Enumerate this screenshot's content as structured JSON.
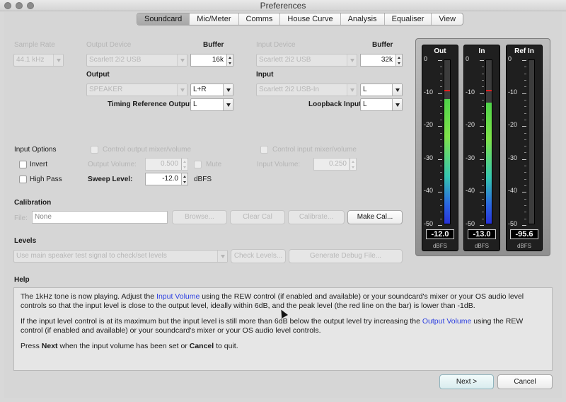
{
  "window": {
    "title": "Preferences"
  },
  "tabs": [
    {
      "label": "Soundcard",
      "active": true
    },
    {
      "label": "Mic/Meter"
    },
    {
      "label": "Comms"
    },
    {
      "label": "House Curve"
    },
    {
      "label": "Analysis"
    },
    {
      "label": "Equaliser"
    },
    {
      "label": "View"
    }
  ],
  "soundcard": {
    "sample_rate_label": "Sample Rate",
    "sample_rate_value": "44.1 kHz",
    "output_device_label": "Output Device",
    "output_device_value": "Scarlett 2i2 USB",
    "output_buffer_label": "Buffer",
    "output_buffer_value": "16k",
    "output_label": "Output",
    "output_value": "SPEAKER",
    "output_channel_value": "L+R",
    "timing_ref_label": "Timing Reference Output",
    "timing_ref_value": "L",
    "input_device_label": "Input Device",
    "input_device_value": "Scarlett 2i2 USB",
    "input_buffer_label": "Buffer",
    "input_buffer_value": "32k",
    "input_label": "Input",
    "input_value": "Scarlett 2i2 USB-In",
    "input_channel_value": "L",
    "loopback_label": "Loopback Input",
    "loopback_value": "L"
  },
  "input_options": {
    "label": "Input Options",
    "invert_label": "Invert",
    "high_pass_label": "High Pass",
    "control_output_label": "Control output mixer/volume",
    "control_input_label": "Control input mixer/volume",
    "output_volume_label": "Output Volume:",
    "output_volume_value": "0.500",
    "mute_label": "Mute",
    "input_volume_label": "Input Volume:",
    "input_volume_value": "0.250",
    "sweep_level_label": "Sweep Level:",
    "sweep_level_value": "-12.0",
    "sweep_level_unit": "dBFS"
  },
  "calibration": {
    "label": "Calibration",
    "file_label": "File:",
    "file_value": "None",
    "browse_label": "Browse...",
    "clear_cal_label": "Clear Cal",
    "calibrate_label": "Calibrate...",
    "make_cal_label": "Make Cal..."
  },
  "levels": {
    "label": "Levels",
    "select_value": "Use main speaker test signal to check/set levels",
    "check_levels_label": "Check Levels...",
    "debug_file_label": "Generate Debug File..."
  },
  "meters": {
    "scale": [
      "0",
      "-10",
      "-20",
      "-30",
      "-40",
      "-50"
    ],
    "items": [
      {
        "title": "Out",
        "reading": "-12.0",
        "unit": "dBFS",
        "level_db": -12.0,
        "peak_db": -9.0
      },
      {
        "title": "In",
        "reading": "-13.0",
        "unit": "dBFS",
        "level_db": -13.0,
        "peak_db": -9.0
      },
      {
        "title": "Ref In",
        "reading": "-95.6",
        "unit": "dBFS",
        "level_db": -95.6,
        "peak_db": null
      }
    ]
  },
  "help": {
    "label": "Help",
    "p1_a": "The 1kHz tone is now playing. Adjust the ",
    "p1_link": "Input Volume",
    "p1_b": " using the REW control (if enabled and available) or your soundcard's mixer or your OS audio level controls so that the input level is close to the output level, ideally within 6dB, and the peak level (the red line on the bar) is lower than -1dB.",
    "p2_a": "If the input level control is at its maximum but the input level is still more than 6dB below the output level try increasing the ",
    "p2_link": "Output Volume",
    "p2_b": " using the REW control (if enabled and available) or your soundcard's mixer or your OS audio level controls.",
    "p3_a": "Press ",
    "p3_next": "Next",
    "p3_b": " when the input volume has been set or ",
    "p3_cancel": "Cancel",
    "p3_c": " to quit."
  },
  "footer": {
    "next_label": "Next >",
    "cancel_label": "Cancel"
  },
  "colors": {
    "link": "#2b3ee0",
    "peak": "#e02020"
  }
}
